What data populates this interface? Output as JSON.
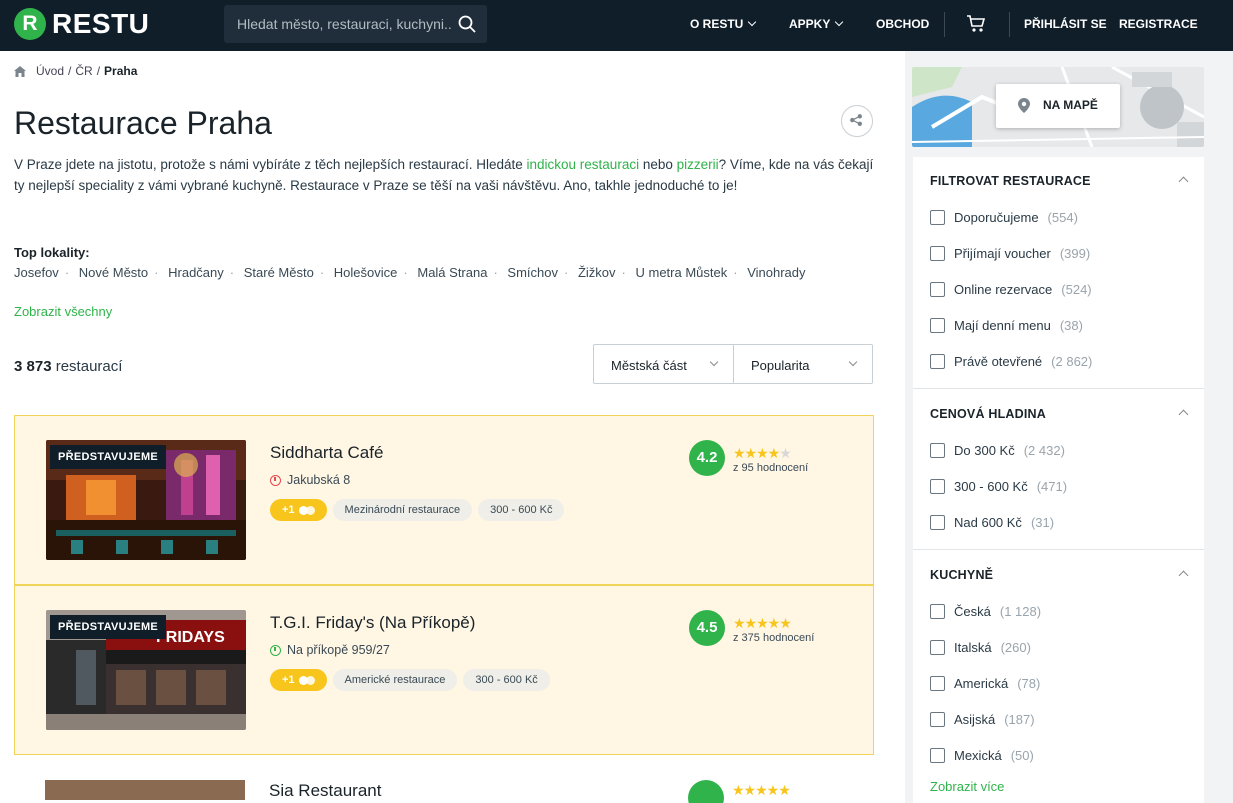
{
  "header": {
    "logo_letter": "R",
    "logo_text": "RESTU",
    "search_placeholder": "Hledat město, restauraci, kuchyni..",
    "nav": [
      "O RESTU",
      "APPKY",
      "OBCHOD"
    ],
    "login": "PŘIHLÁSIT SE",
    "register": "REGISTRACE"
  },
  "breadcrumb": {
    "home": "Úvod",
    "sep": "/",
    "country": "ČR",
    "current": "Praha"
  },
  "page_title": "Restaurace Praha",
  "intro": {
    "p1": "V Praze jdete na jistotu, protože s námi vybíráte z těch nejlepších restaurací. Hledáte ",
    "link1": "indickou restauraci",
    "p2": " nebo ",
    "link2": "pizzerii",
    "p3": "? Víme, kde na vás čekají ty nejlepší speciality z vámi vybrané kuchyně. Restaurace v Praze se těší na vaši návštěvu. Ano, takhle jednoduché to je!"
  },
  "top_localities": {
    "title": "Top lokality:",
    "items": [
      "Josefov",
      "Nové Město",
      "Hradčany",
      "Staré Město",
      "Holešovice",
      "Malá Strana",
      "Smíchov",
      "Žižkov",
      "U metra Můstek",
      "Vinohrady"
    ],
    "show_all": "Zobrazit všechny"
  },
  "results": {
    "count": "3 873",
    "label": "restaurací"
  },
  "sort": {
    "district": "Městská část",
    "order": "Popularita"
  },
  "listings": [
    {
      "badge": "PŘEDSTAVUJEME",
      "name": "Siddharta Café",
      "address": "Jakubská 8",
      "voucher": "+1",
      "cuisine": "Mezinárodní restaurace",
      "price": "300 - 600 Kč",
      "rating": "4.2",
      "stars": 4,
      "reviews": "z 95 hodnocení",
      "open": false
    },
    {
      "badge": "PŘEDSTAVUJEME",
      "name": "T.G.I. Friday's (Na Příkopě)",
      "address": "Na příkopě 959/27",
      "voucher": "+1",
      "cuisine": "Americké restaurace",
      "price": "300 - 600 Kč",
      "rating": "4.5",
      "stars": 5,
      "reviews": "z 375 hodnocení",
      "open": true
    },
    {
      "name": "Sia Restaurant"
    }
  ],
  "map_button": "NA MAPĚ",
  "filters": [
    {
      "title": "FILTROVAT RESTAURACE",
      "items": [
        {
          "label": "Doporučujeme",
          "count": "(554)"
        },
        {
          "label": "Přijímají voucher",
          "count": "(399)"
        },
        {
          "label": "Online rezervace",
          "count": "(524)"
        },
        {
          "label": "Mají denní menu",
          "count": "(38)"
        },
        {
          "label": "Právě otevřené",
          "count": "(2 862)"
        }
      ]
    },
    {
      "title": "CENOVÁ HLADINA",
      "items": [
        {
          "label": "Do 300 Kč",
          "count": "(2 432)"
        },
        {
          "label": "300 - 600 Kč",
          "count": "(471)"
        },
        {
          "label": "Nad 600 Kč",
          "count": "(31)"
        }
      ]
    },
    {
      "title": "KUCHYNĚ",
      "items": [
        {
          "label": "Česká",
          "count": "(1 128)"
        },
        {
          "label": "Italská",
          "count": "(260)"
        },
        {
          "label": "Americká",
          "count": "(78)"
        },
        {
          "label": "Asijská",
          "count": "(187)"
        },
        {
          "label": "Mexická",
          "count": "(50)"
        }
      ],
      "show_more": "Zobrazit více"
    }
  ],
  "colors": {
    "brand": "#2fb34a",
    "header_bg": "#0f1e29",
    "highlight_bg": "#fff6e4",
    "star": "#f7c51b"
  }
}
